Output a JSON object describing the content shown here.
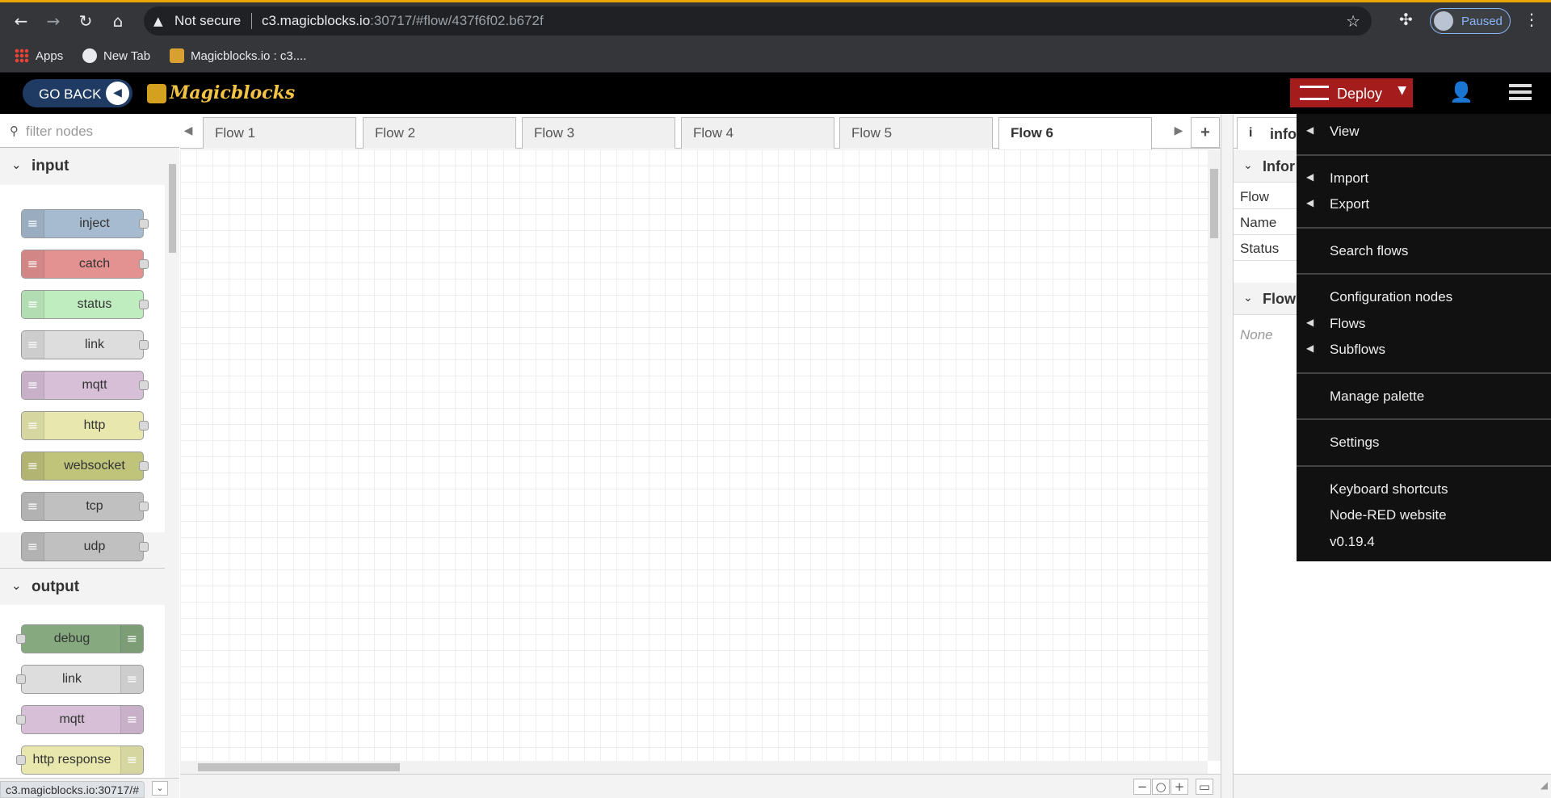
{
  "browser": {
    "security_label": "Not secure",
    "url_host": "c3.magicblocks.io",
    "url_rest": ":30717/#flow/437f6f02.b672f",
    "profile_label": "Paused",
    "bookmarks": [
      {
        "label": "Apps"
      },
      {
        "label": "New Tab"
      },
      {
        "label": "Magicblocks.io : c3...."
      }
    ],
    "status_url": "c3.magicblocks.io:30717/#"
  },
  "header": {
    "go_back_label": "GO BACK",
    "logo_text": "Magicblocks",
    "deploy_label": "Deploy"
  },
  "palette": {
    "filter_placeholder": "filter nodes",
    "categories": [
      {
        "label": "input",
        "nodes": [
          {
            "label": "inject",
            "color": "#a6bbcf"
          },
          {
            "label": "catch",
            "color": "#e49191"
          },
          {
            "label": "status",
            "color": "#c0edc0"
          },
          {
            "label": "link",
            "color": "#dddddd"
          },
          {
            "label": "mqtt",
            "color": "#d8bfd8"
          },
          {
            "label": "http",
            "color": "#e7e7ae"
          },
          {
            "label": "websocket",
            "color": "#c0c37a"
          },
          {
            "label": "tcp",
            "color": "#c0c0c0"
          },
          {
            "label": "udp",
            "color": "#c0c0c0"
          }
        ]
      },
      {
        "label": "output",
        "nodes": [
          {
            "label": "debug",
            "color": "#87a980"
          },
          {
            "label": "link",
            "color": "#dddddd"
          },
          {
            "label": "mqtt",
            "color": "#d8bfd8"
          },
          {
            "label": "http response",
            "color": "#e7e7ae"
          }
        ]
      }
    ]
  },
  "tabs": [
    {
      "label": "Flow 1"
    },
    {
      "label": "Flow 2"
    },
    {
      "label": "Flow 3"
    },
    {
      "label": "Flow 4"
    },
    {
      "label": "Flow 5"
    },
    {
      "label": "Flow 6",
      "active": true
    }
  ],
  "sidebar": {
    "tab_label": "info",
    "info_section": "Infor",
    "rows": [
      "Flow",
      "Name",
      "Status"
    ],
    "flow_section": "Flow",
    "none_text": "None"
  },
  "menu": {
    "items": [
      {
        "label": "View",
        "arrow": true
      },
      {
        "label": "Import",
        "arrow": true
      },
      {
        "label": "Export",
        "arrow": true
      },
      {
        "label": "Search flows",
        "arrow": false
      },
      {
        "label": "Configuration nodes",
        "arrow": false
      },
      {
        "label": "Flows",
        "arrow": true
      },
      {
        "label": "Subflows",
        "arrow": true
      },
      {
        "label": "Manage palette",
        "arrow": false
      },
      {
        "label": "Settings",
        "arrow": false
      },
      {
        "label": "Keyboard shortcuts",
        "arrow": false
      },
      {
        "label": "Node-RED website",
        "arrow": false
      },
      {
        "label": "v0.19.4",
        "arrow": false
      }
    ]
  }
}
